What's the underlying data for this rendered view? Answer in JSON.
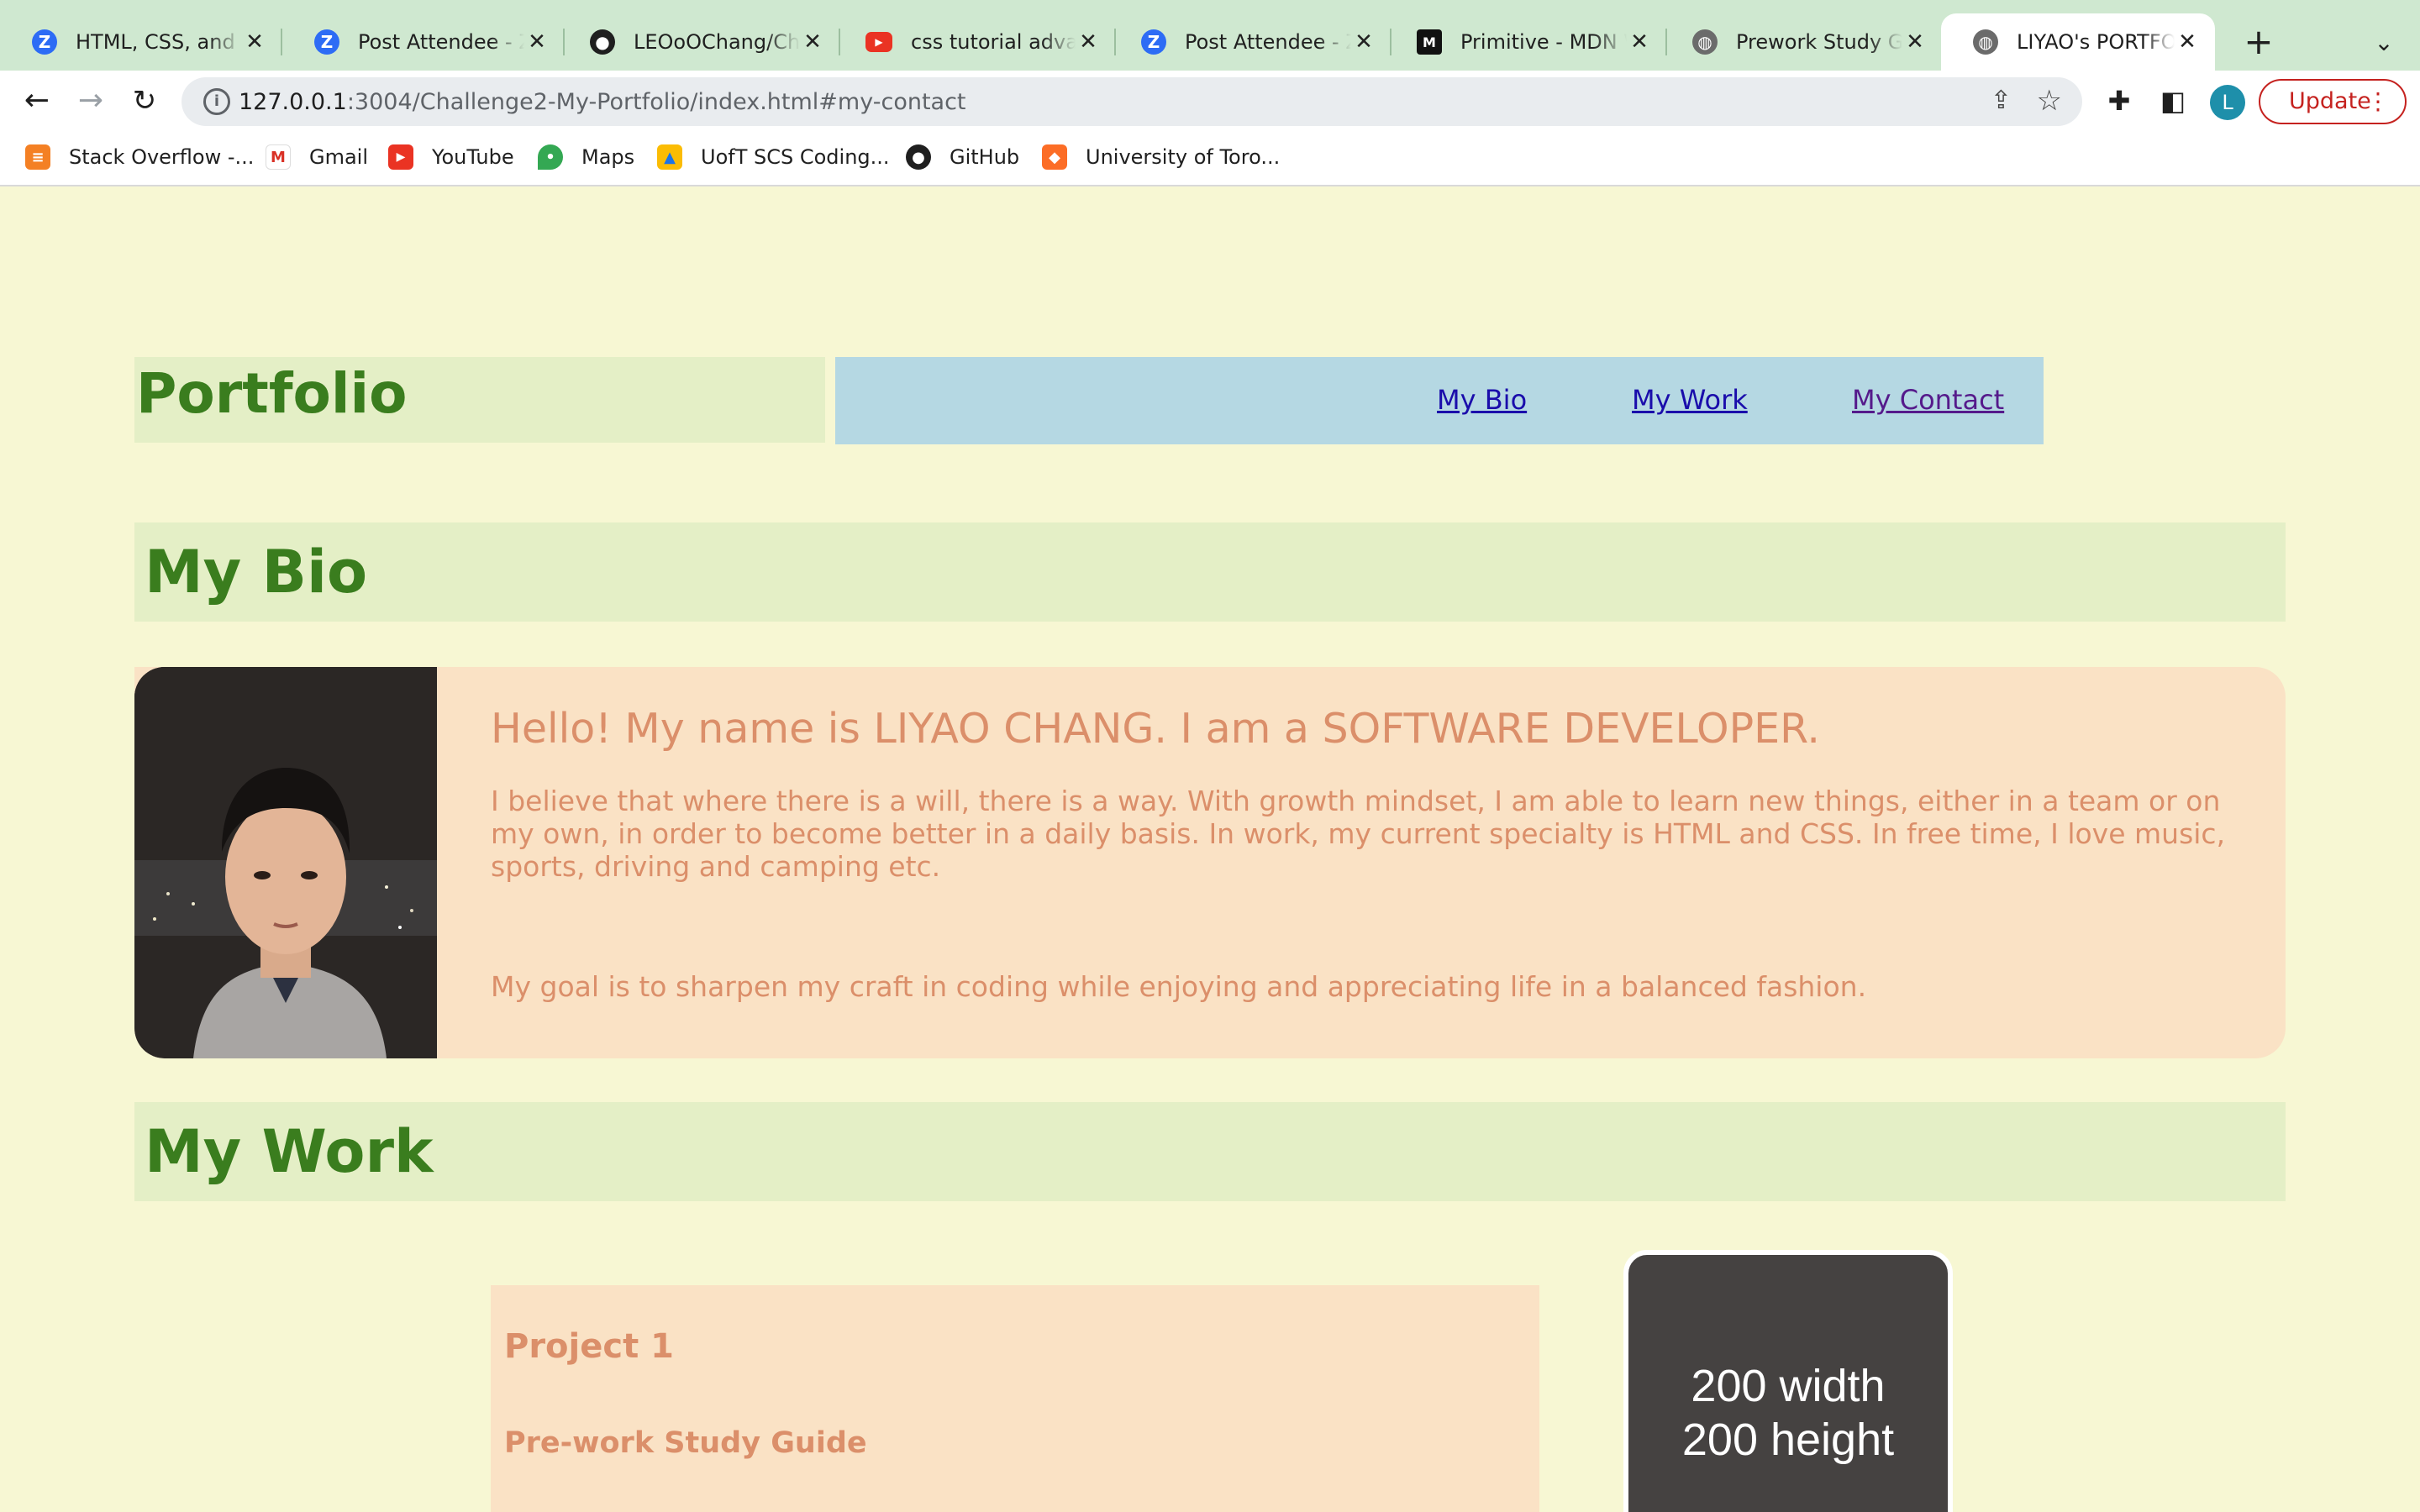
{
  "browser": {
    "tabs": [
      {
        "title": "HTML, CSS, and Gi",
        "favicon": "zoom-icon",
        "active": false
      },
      {
        "title": "Post Attendee - Zoom",
        "favicon": "zoom-icon",
        "active": false
      },
      {
        "title": "LEOoOChang/Challenge",
        "favicon": "github-icon",
        "active": false
      },
      {
        "title": "css tutorial advanced",
        "favicon": "youtube-icon",
        "active": false
      },
      {
        "title": "Post Attendee - Zoom",
        "favicon": "zoom-icon",
        "active": false
      },
      {
        "title": "Primitive - MDN Web",
        "favicon": "mdn-icon",
        "active": false
      },
      {
        "title": "Prework Study Guide",
        "favicon": "globe-icon",
        "active": false
      },
      {
        "title": "LIYAO's PORTFOLIO",
        "favicon": "globe-icon",
        "active": true
      }
    ],
    "address": {
      "host": "127.0.0.1",
      "rest": ":3004/Challenge2-My-Portfolio/index.html#my-contact"
    },
    "update_label": "Update",
    "profile_initial": "L",
    "bookmarks": [
      {
        "label": "Stack Overflow -...",
        "icon": "stackoverflow-icon"
      },
      {
        "label": "Gmail",
        "icon": "gmail-icon"
      },
      {
        "label": "YouTube",
        "icon": "youtube-icon"
      },
      {
        "label": "Maps",
        "icon": "maps-icon"
      },
      {
        "label": "UofT SCS Coding...",
        "icon": "drive-icon"
      },
      {
        "label": "GitHub",
        "icon": "github-icon"
      },
      {
        "label": "University of Toro...",
        "icon": "gitlab-icon"
      }
    ]
  },
  "site": {
    "brand": "Portfolio",
    "nav": [
      "My Bio",
      "My Work",
      "My Contact"
    ],
    "bio": {
      "heading": "My Bio",
      "intro": "Hello! My name is LIYAO CHANG. I am a SOFTWARE DEVELOPER.",
      "paragraph1": "I believe that where there is a will, there is a way. With growth mindset, I am able to learn new things, either in a team or on my own, in order to become better in a daily basis. In work, my current specialty is HTML and CSS. In free time, I love music, sports, driving and camping etc.",
      "paragraph2": "My goal is to sharpen my craft in coding while enjoying and appreciating life in a balanced fashion."
    },
    "work": {
      "heading": "My Work",
      "project_title": "Project 1",
      "project_subtitle": "Pre-work Study Guide",
      "placeholder_line1": "200 width",
      "placeholder_line2": "200 height"
    }
  },
  "colors": {
    "page_bg": "#f7f7d3",
    "header_green": "#3a7d1e",
    "section_bg": "#e4efc6",
    "nav_bg": "#b5d8e3",
    "card_bg": "#fae2c5",
    "card_text": "#db8f6a"
  }
}
